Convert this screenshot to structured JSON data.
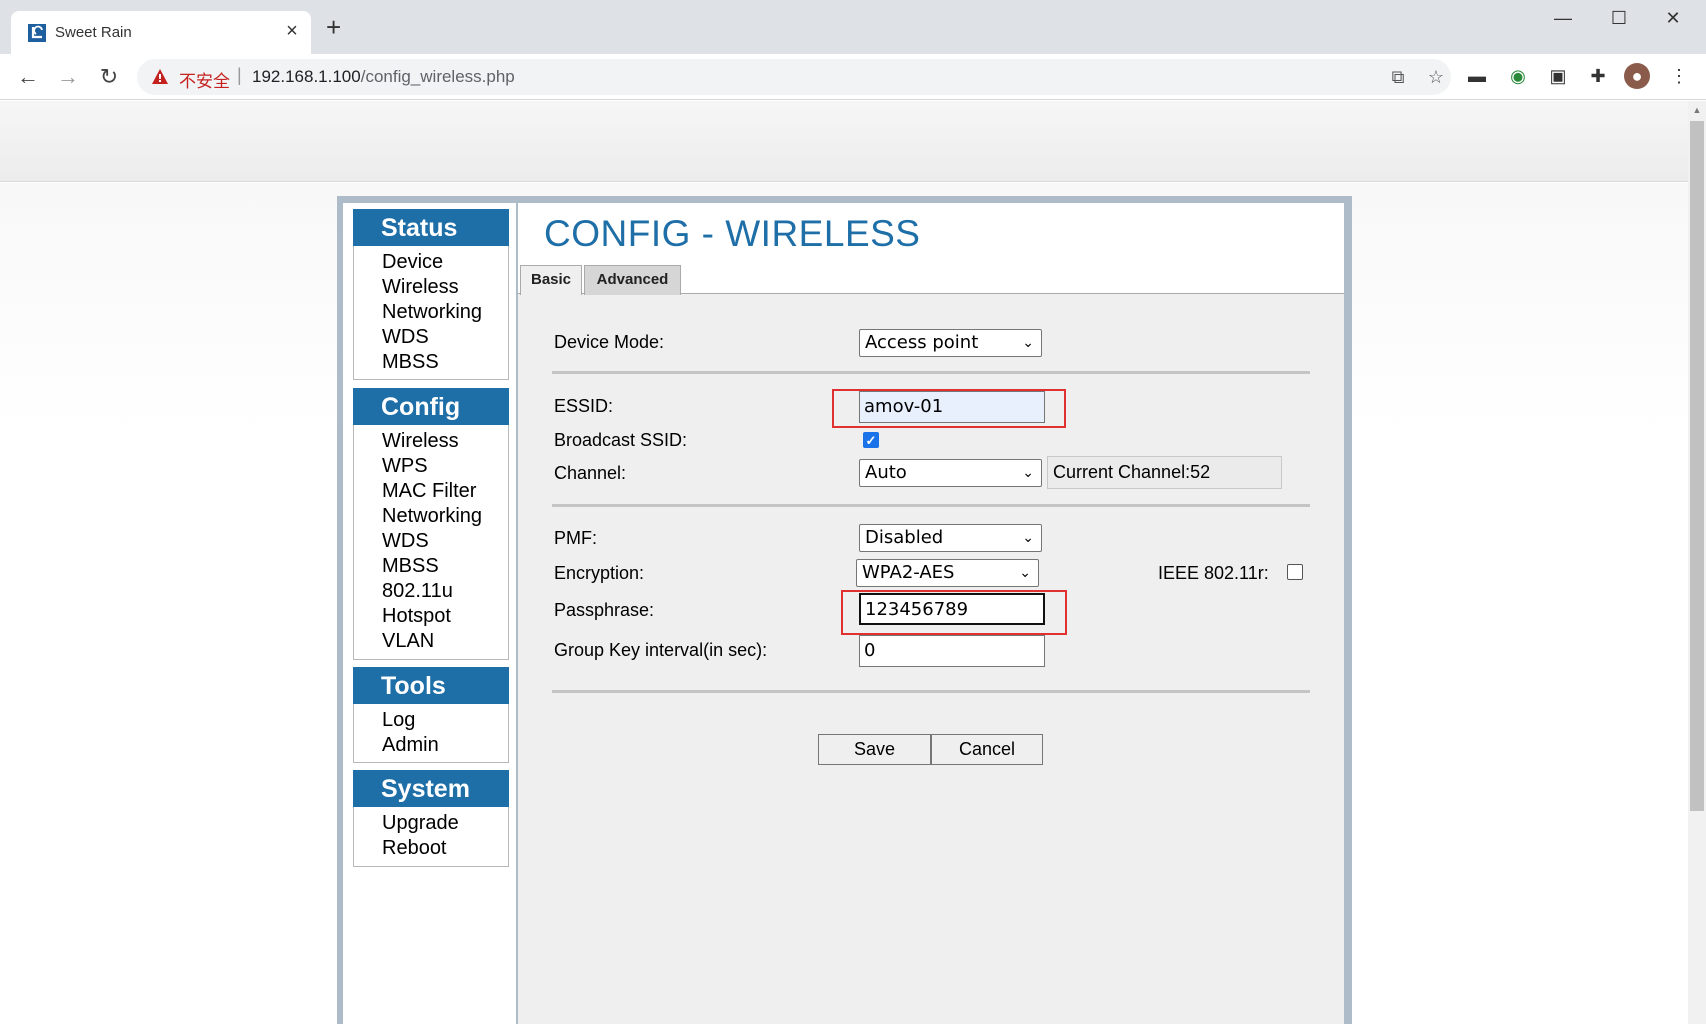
{
  "browser": {
    "tab_title": "Sweet Rain",
    "tab_close": "×",
    "new_tab": "+",
    "window_minimize": "—",
    "window_maximize": "☐",
    "window_close": "✕",
    "security_label": "不安全",
    "separator": "|",
    "url_host": "192.168.1.100",
    "url_path": "/config_wireless.php"
  },
  "sidebar": {
    "sections": [
      {
        "title": "Status",
        "items": [
          "Device",
          "Wireless",
          "Networking",
          "WDS",
          "MBSS"
        ]
      },
      {
        "title": "Config",
        "items": [
          "Wireless",
          "WPS",
          "MAC Filter",
          "Networking",
          "WDS",
          "MBSS",
          "802.11u",
          "Hotspot",
          "VLAN"
        ]
      },
      {
        "title": "Tools",
        "items": [
          "Log",
          "Admin"
        ]
      },
      {
        "title": "System",
        "items": [
          "Upgrade",
          "Reboot"
        ]
      }
    ]
  },
  "main": {
    "title": "CONFIG - WIRELESS",
    "tabs": [
      {
        "label": "Basic",
        "active": true
      },
      {
        "label": "Advanced",
        "active": false
      }
    ],
    "device_mode_label": "Device Mode:",
    "device_mode_value": "Access point",
    "essid_label": "ESSID:",
    "essid_value": "amov-01",
    "broadcast_label": "Broadcast SSID:",
    "broadcast_checked": true,
    "channel_label": "Channel:",
    "channel_value": "Auto",
    "current_channel": "Current Channel:52",
    "pmf_label": "PMF:",
    "pmf_value": "Disabled",
    "encryption_label": "Encryption:",
    "encryption_value": "WPA2-AES",
    "ieee_label": "IEEE 802.11r:",
    "ieee_checked": false,
    "passphrase_label": "Passphrase:",
    "passphrase_value": "123456789",
    "group_key_label": "Group Key interval(in sec):",
    "group_key_value": "0",
    "save_label": "Save",
    "cancel_label": "Cancel"
  },
  "colors": {
    "accent": "#1e6ea7",
    "highlight_box": "#e03030"
  }
}
